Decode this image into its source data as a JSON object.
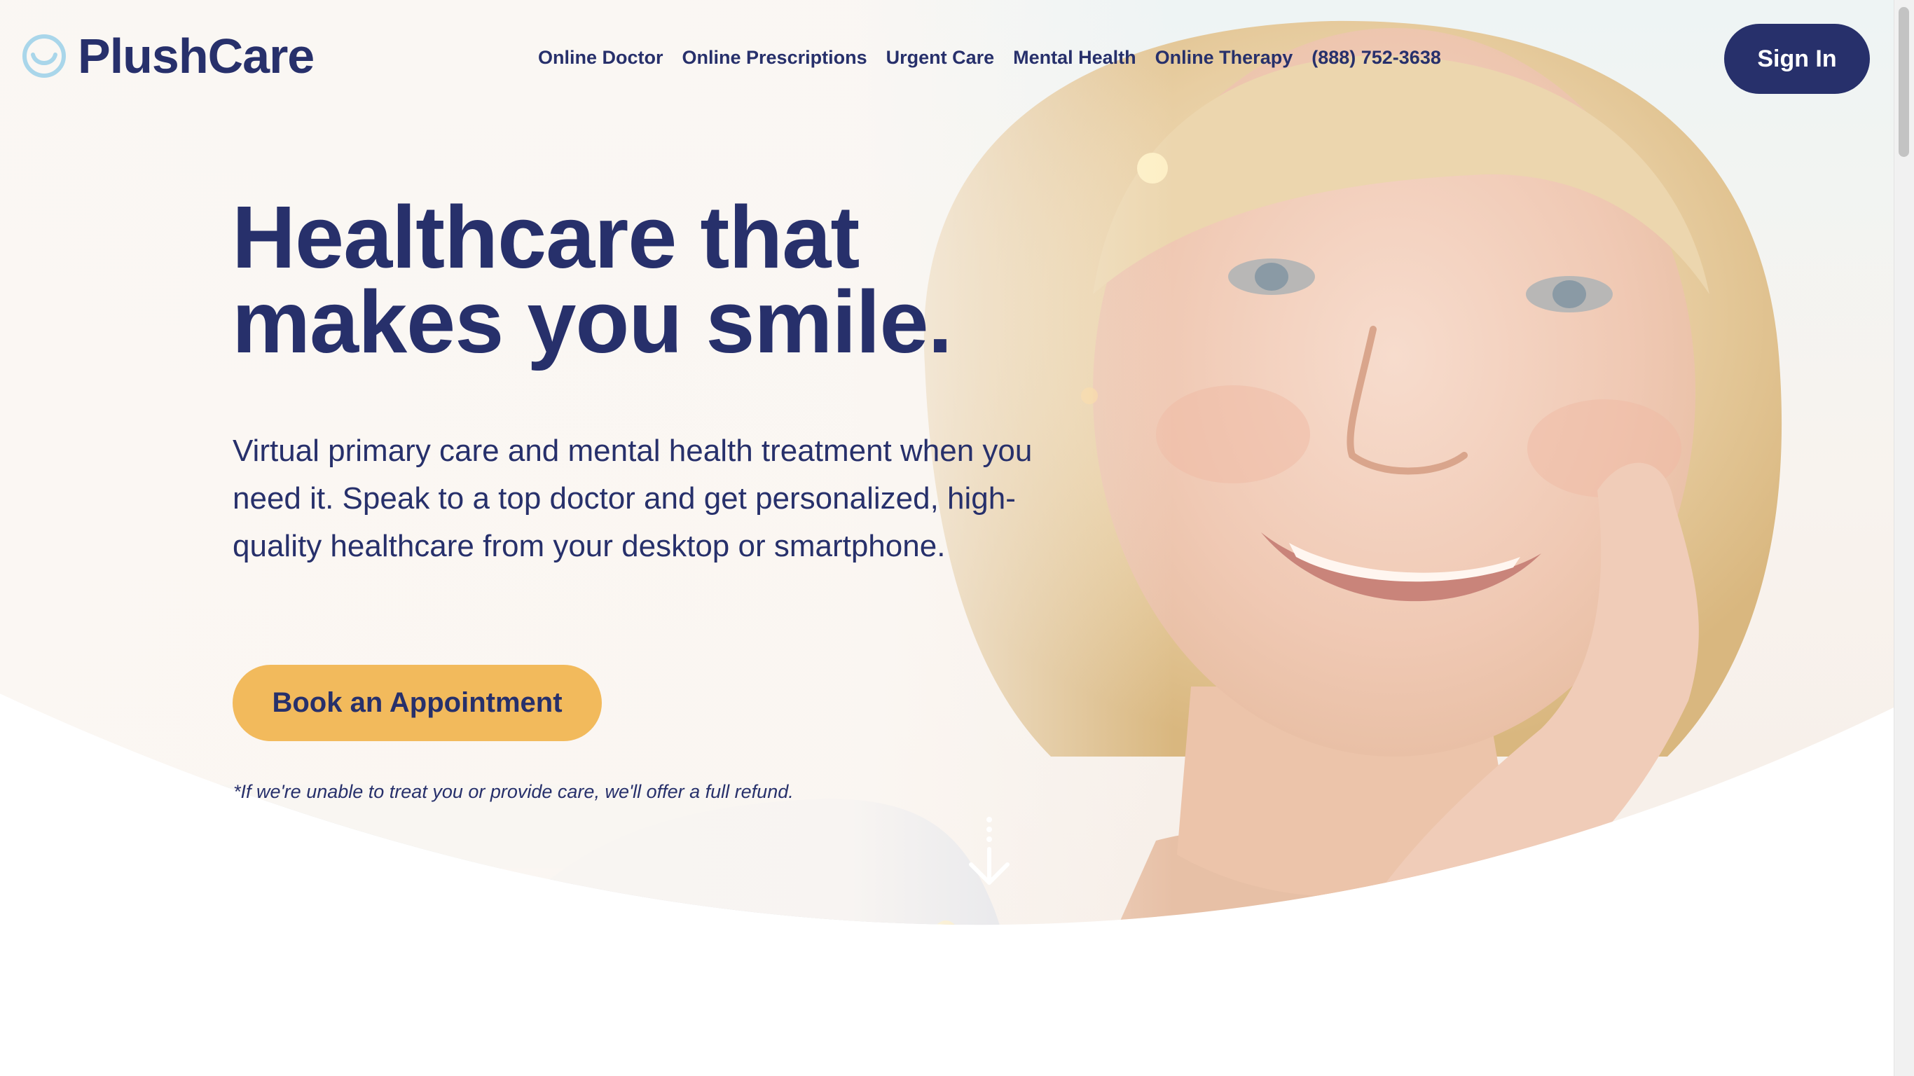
{
  "brand": {
    "name": "PlushCare",
    "logo_icon": "smile-circle-icon"
  },
  "nav": {
    "items": [
      {
        "label": "Online Doctor"
      },
      {
        "label": "Online Prescriptions"
      },
      {
        "label": "Urgent Care"
      },
      {
        "label": "Mental Health"
      },
      {
        "label": "Online Therapy"
      },
      {
        "label": "(888) 752-3638"
      }
    ],
    "sign_in_label": "Sign In"
  },
  "hero": {
    "title_line1": "Healthcare that",
    "title_line2": "makes you smile.",
    "subtitle": "Virtual primary care and mental health treatment when you need it. Speak to a top doctor and get personalized, high-quality healthcare from your desktop or smartphone.",
    "cta_label": "Book an Appointment",
    "refund_note": "*If we're unable to treat you or provide care, we'll offer a full refund.",
    "scroll_icon": "arrow-down-icon"
  },
  "colors": {
    "navy": "#27306b",
    "accent_yellow": "#f2ba5c",
    "logo_light_blue": "#a9d6ea",
    "background": "#ffffff"
  }
}
